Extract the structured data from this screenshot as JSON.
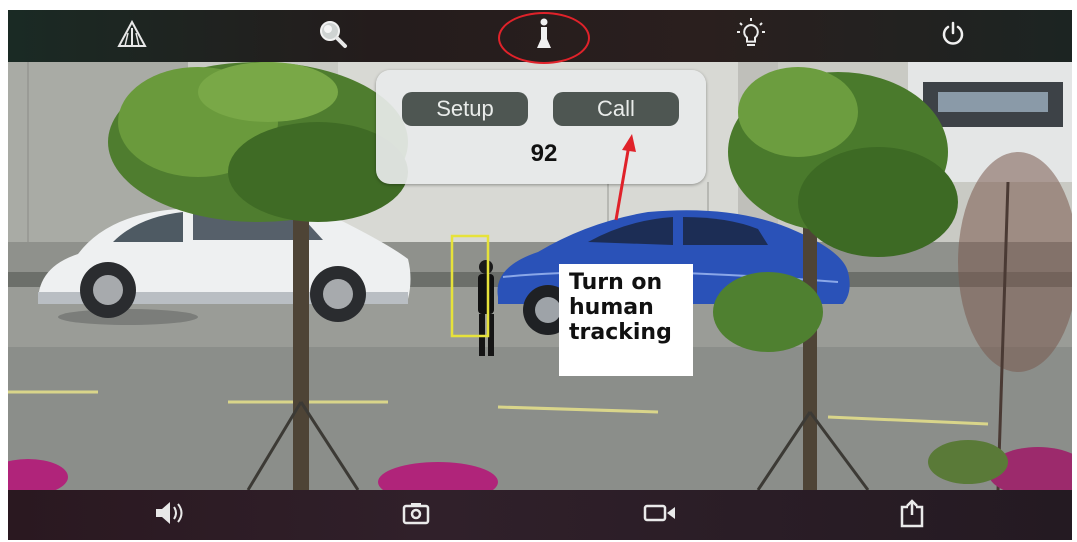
{
  "toolbar": {
    "items": [
      {
        "name": "alarm-icon",
        "label": "Alarm"
      },
      {
        "name": "zoom-icon",
        "label": "Zoom"
      },
      {
        "name": "human-tracking-icon",
        "label": "Human tracking",
        "highlighted": true
      },
      {
        "name": "light-bulb-icon",
        "label": "Light"
      },
      {
        "name": "power-icon",
        "label": "Power"
      }
    ]
  },
  "ptz_popup": {
    "setup_label": "Setup",
    "call_label": "Call",
    "preset_number": "92"
  },
  "callout": {
    "text": "Turn on\nhuman\ntracking"
  },
  "bottom_bar": {
    "items": [
      {
        "name": "speaker-icon",
        "label": "Audio"
      },
      {
        "name": "camera-snapshot-icon",
        "label": "Snapshot"
      },
      {
        "name": "video-record-icon",
        "label": "Record"
      },
      {
        "name": "share-icon",
        "label": "Share"
      }
    ]
  },
  "colors": {
    "highlight": "#e0222a",
    "tracking_box": "#e6e23a",
    "popup_button": "#4e5652"
  }
}
